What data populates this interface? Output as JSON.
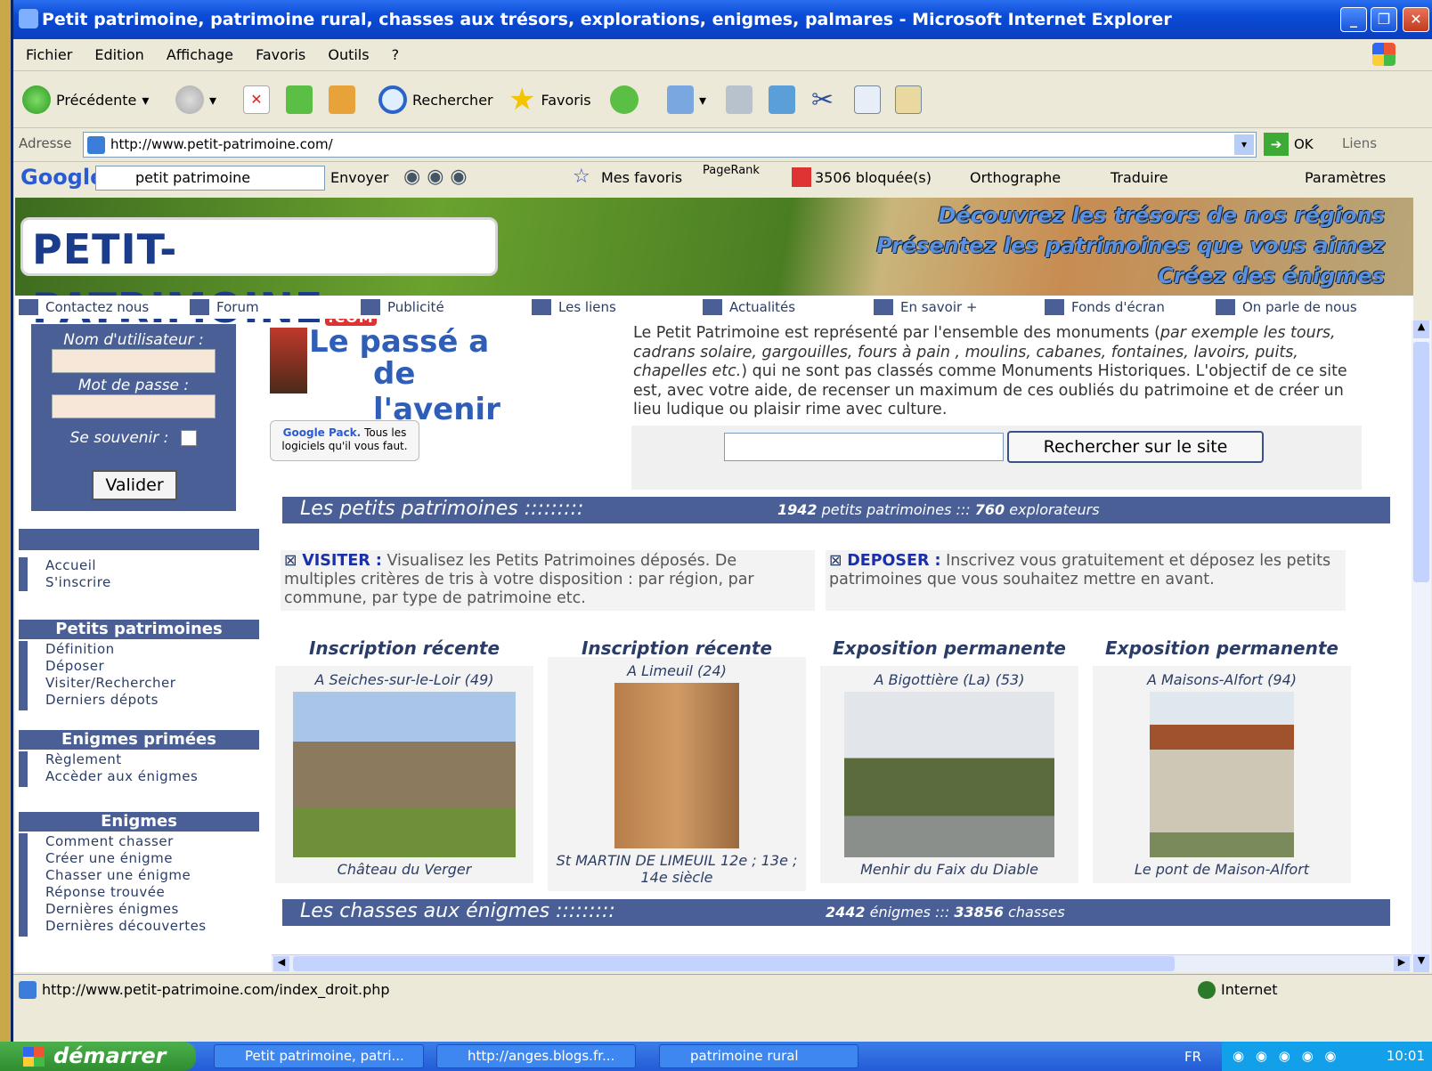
{
  "window": {
    "title": "Petit patrimoine, patrimoine rural, chasses aux trésors, explorations, enigmes, palmares - Microsoft Internet Explorer",
    "min": "_",
    "max": "❐",
    "close": "✕"
  },
  "menu": [
    "Fichier",
    "Edition",
    "Affichage",
    "Favoris",
    "Outils",
    "?"
  ],
  "toolbar": {
    "back": "Précédente",
    "search": "Rechercher",
    "favorites": "Favoris"
  },
  "address": {
    "label": "Adresse",
    "url": "http://www.petit-patrimoine.com/",
    "go": "OK",
    "links": "Liens"
  },
  "googlebar": {
    "logo": "Google",
    "query": "petit patrimoine",
    "send": "Envoyer",
    "myfav": "Mes favoris",
    "pagerank": "PageRank",
    "blocked": "3506 bloquée(s)",
    "spell": "Orthographe",
    "translate": "Traduire",
    "settings": "Paramètres"
  },
  "site": {
    "logo": "PETIT-PATRIMOINE",
    "logo_suffix": ".COM",
    "slogans": [
      "Découvrez les trésors de nos régions",
      "Présentez les patrimoines que vous aimez",
      "Créez des énigmes"
    ],
    "nav": [
      "Contactez nous",
      "Forum",
      "Publicité",
      "Les liens",
      "Actualités",
      "En savoir +",
      "Fonds d'écran",
      "On parle de nous"
    ],
    "login": {
      "user": "Nom d'utilisateur :",
      "pass": "Mot de passe :",
      "remember": "Se souvenir :",
      "submit": "Valider"
    },
    "side_top": [
      "Accueil",
      "S'inscrire"
    ],
    "side_sections": [
      {
        "title": "Petits patrimoines",
        "items": [
          "Définition",
          "Déposer",
          "Visiter/Rechercher",
          "Derniers dépots"
        ]
      },
      {
        "title": "Enigmes primées",
        "items": [
          "Règlement",
          "Accèder aux énigmes"
        ]
      },
      {
        "title": "Enigmes",
        "items": [
          "Comment chasser",
          "Créer une énigme",
          "Chasser une énigme",
          "Réponse trouvée",
          "Dernières énigmes",
          "Dernières découvertes"
        ]
      }
    ],
    "tagline1": "Le passé a",
    "tagline2": "de l'avenir",
    "gpack_brand": "Google Pack.",
    "gpack_text": "Tous les logiciels qu'il vous faut.",
    "intro": {
      "p1": "Le Petit Patrimoine est représenté par l'ensemble des monuments (",
      "p1_em": "par exemple les tours, cadrans solaire, gargouilles, fours à pain , moulins, cabanes, fontaines, lavoirs, puits, chapelles etc.",
      "p2": ") qui ne sont pas classés comme Monuments Historiques. L'objectif de ce site est, avec votre aide, de recenser un maximum de ces oubliés du patrimoine et de créer un lieu ludique ou plaisir rime avec culture."
    },
    "search_button": "Rechercher sur le site",
    "band1": {
      "title": "Les petits patrimoines :::::::::",
      "n1": "1942",
      "t1": " petits patrimoines ::: ",
      "n2": "760",
      "t2": " explorateurs"
    },
    "visiter": {
      "label": "VISITER :",
      "text": " Visualisez les Petits Patrimoines déposés. De multiples critères de tris à votre disposition : par région, par commune, par type de patrimoine etc."
    },
    "deposer": {
      "label": "DEPOSER :",
      "text": " Inscrivez vous gratuitement et déposez les petits patrimoines que vous souhaitez mettre en avant."
    },
    "cards": [
      {
        "head": "Inscription récente",
        "place": "A Seiches-sur-le-Loir (49)",
        "caption": "Château du Verger"
      },
      {
        "head": "Inscription récente",
        "place": "A Limeuil (24)",
        "caption": "St MARTIN DE LIMEUIL 12e ; 13e ; 14e siècle"
      },
      {
        "head": "Exposition permanente",
        "place": "A Bigottière (La) (53)",
        "caption": "Menhir du Faix du Diable"
      },
      {
        "head": "Exposition permanente",
        "place": "A Maisons-Alfort (94)",
        "caption": "Le pont de Maison-Alfort"
      }
    ],
    "band2": {
      "title": "Les chasses aux énigmes :::::::::",
      "n1": "2442",
      "t1": " énigmes ::: ",
      "n2": "33856",
      "t2": " chasses"
    }
  },
  "status": {
    "url": "http://www.petit-patrimoine.com/index_droit.php",
    "zone": "Internet"
  },
  "taskbar": {
    "start": "démarrer",
    "tasks": [
      "Petit patrimoine, patri...",
      "http://anges.blogs.fr...",
      "patrimoine rural"
    ],
    "lang": "FR",
    "time": "10:01"
  }
}
